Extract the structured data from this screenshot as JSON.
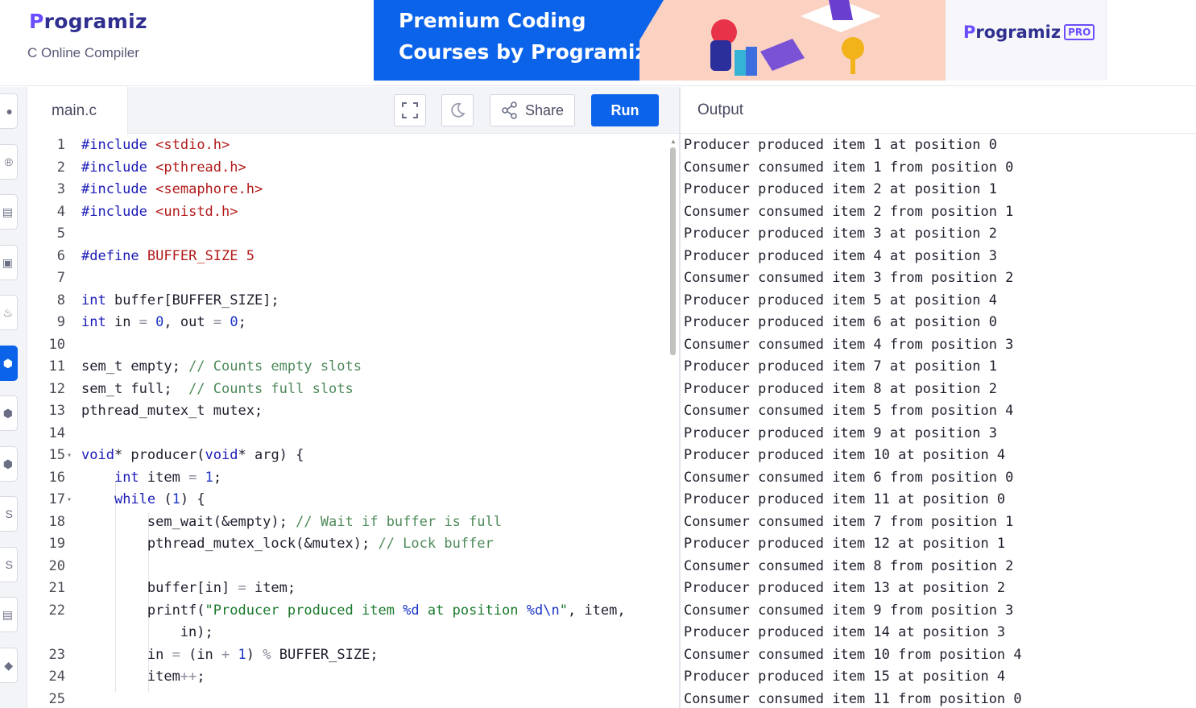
{
  "header": {
    "logo": "rogramiz",
    "logo_initial": "P",
    "subtitle": "C Online Compiler"
  },
  "banner": {
    "title_line1": "Premium Coding",
    "title_line2": "Courses by Programiz",
    "logo": "rogramiz",
    "logo_initial": "P",
    "badge": "PRO"
  },
  "editor": {
    "file_tab": "main.c",
    "share_label": "Share",
    "run_label": "Run"
  },
  "output": {
    "title": "Output",
    "lines": [
      "Producer produced item 1 at position 0",
      "Consumer consumed item 1 from position 0",
      "Producer produced item 2 at position 1",
      "Consumer consumed item 2 from position 1",
      "Producer produced item 3 at position 2",
      "Producer produced item 4 at position 3",
      "Consumer consumed item 3 from position 2",
      "Producer produced item 5 at position 4",
      "Producer produced item 6 at position 0",
      "Consumer consumed item 4 from position 3",
      "Producer produced item 7 at position 1",
      "Producer produced item 8 at position 2",
      "Consumer consumed item 5 from position 4",
      "Producer produced item 9 at position 3",
      "Producer produced item 10 at position 4",
      "Consumer consumed item 6 from position 0",
      "Producer produced item 11 at position 0",
      "Consumer consumed item 7 from position 1",
      "Producer produced item 12 at position 1",
      "Consumer consumed item 8 from position 2",
      "Producer produced item 13 at position 2",
      "Consumer consumed item 9 from position 3",
      "Producer produced item 14 at position 3",
      "Consumer consumed item 10 from position 4",
      "Producer produced item 15 at position 4",
      "Consumer consumed item 11 from position 0"
    ]
  },
  "code_lines": [
    {
      "n": "1",
      "text": "#include <stdio.h>"
    },
    {
      "n": "2",
      "text": "#include <pthread.h>"
    },
    {
      "n": "3",
      "text": "#include <semaphore.h>"
    },
    {
      "n": "4",
      "text": "#include <unistd.h>"
    },
    {
      "n": "5",
      "text": ""
    },
    {
      "n": "6",
      "text": "#define BUFFER_SIZE 5"
    },
    {
      "n": "7",
      "text": ""
    },
    {
      "n": "8",
      "text": "int buffer[BUFFER_SIZE];"
    },
    {
      "n": "9",
      "text": "int in = 0, out = 0;"
    },
    {
      "n": "10",
      "text": ""
    },
    {
      "n": "11",
      "text": "sem_t empty; // Counts empty slots"
    },
    {
      "n": "12",
      "text": "sem_t full;  // Counts full slots"
    },
    {
      "n": "13",
      "text": "pthread_mutex_t mutex;"
    },
    {
      "n": "14",
      "text": ""
    },
    {
      "n": "15",
      "text": "void* producer(void* arg) {",
      "fold": true
    },
    {
      "n": "16",
      "text": "    int item = 1;"
    },
    {
      "n": "17",
      "text": "    while (1) {",
      "fold": true
    },
    {
      "n": "18",
      "text": "        sem_wait(&empty); // Wait if buffer is full"
    },
    {
      "n": "19",
      "text": "        pthread_mutex_lock(&mutex); // Lock buffer"
    },
    {
      "n": "20",
      "text": ""
    },
    {
      "n": "21",
      "text": "        buffer[in] = item;"
    },
    {
      "n": "22",
      "text": "        printf(\"Producer produced item %d at position %d\\n\", item,"
    },
    {
      "n": "",
      "text": "            in);"
    },
    {
      "n": "23",
      "text": "        in = (in + 1) % BUFFER_SIZE;"
    },
    {
      "n": "24",
      "text": "        item++;"
    },
    {
      "n": "25",
      "text": ""
    }
  ],
  "colors": {
    "brand_blue": "#0b63ea",
    "brand_purple": "#6b4dff",
    "keyword": "#1c1cb8",
    "string": "#1b7a2c",
    "include_path": "#b31b1b",
    "comment": "#4e8a5a"
  }
}
